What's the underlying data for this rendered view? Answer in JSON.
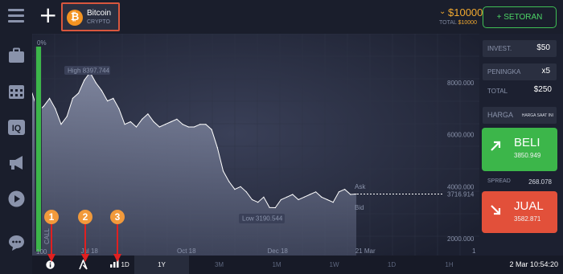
{
  "topbar": {
    "asset_name": "Bitcoin",
    "asset_type": "CRYPTO",
    "balance": "$10000",
    "total_label": "TOTAL",
    "total_value": "$10000",
    "deposit_label": "+ SETORAN",
    "coin_symbol": "₿"
  },
  "sidebar": {
    "icons": [
      "menu-icon",
      "briefcase-icon",
      "calendar-icon",
      "iq-icon",
      "megaphone-icon",
      "play-icon",
      "chat-icon"
    ]
  },
  "chart": {
    "high_label": "High",
    "high_value": "8397.744",
    "low_label": "Low",
    "low_value": "3190.544",
    "current_value": "3716.914",
    "ask_label": "Ask",
    "bid_label": "Bid",
    "left_pct_label": "0%",
    "call_label": "CALL",
    "left_bottom_label": "100",
    "y_ticks": [
      "8000.000",
      "6000.000",
      "4000.000",
      "2000.000"
    ],
    "x_ticks": [
      "Jul 18",
      "Oct 18",
      "Dec 18",
      "21 Mar"
    ],
    "x_edge_label": "1"
  },
  "chart_data": {
    "type": "area",
    "title": "",
    "xlabel": "",
    "ylabel": "",
    "ylim": [
      2000,
      9000
    ],
    "x_ticks": [
      "Jul 18",
      "Oct 18",
      "Dec 18",
      "21 Mar"
    ],
    "series": [
      {
        "values": [
          7600,
          6900,
          7100,
          7400,
          7000,
          6400,
          6700,
          7400,
          7600,
          8100,
          8397.744,
          8000,
          7700,
          7300,
          7400,
          7000,
          6400,
          6500,
          6300,
          6600,
          6800,
          6500,
          6300,
          6400,
          6500,
          6600,
          6400,
          6300,
          6300,
          6400,
          6400,
          6200,
          5500,
          4600,
          4200,
          3900,
          4000,
          3800,
          3500,
          3400,
          3600,
          3200,
          3190.544,
          3500,
          3600,
          3700,
          3500,
          3600,
          3700,
          3800,
          3600,
          3500,
          3400,
          3800,
          3900,
          3700,
          3716.914
        ]
      }
    ]
  },
  "rpanel": {
    "invest_label": "INVEST.",
    "invest_value": "$50",
    "multiplier_label": "PENINGKA",
    "multiplier_value": "x5",
    "total_label": "TOTAL",
    "total_value": "$250",
    "price_label": "HARGA",
    "price_sub": "HARGA SAAT INI",
    "buy_label": "BELI",
    "buy_price": "3850.949",
    "spread_label": "SPREAD",
    "spread_value": "268.078",
    "sell_label": "JUAL",
    "sell_price": "3582.871"
  },
  "bottombar": {
    "timeframe_label": "1D",
    "periods": [
      "1Y",
      "3M",
      "1M",
      "1W",
      "1D",
      "1H"
    ],
    "active_period": "1Y",
    "clock": "2 Mar 10:54:20"
  },
  "annotations": {
    "markers": [
      "1",
      "2",
      "3"
    ]
  },
  "colors": {
    "accent_orange": "#f39321",
    "balance_gold": "#f0a830",
    "buy_green": "#3cb64a",
    "sell_red": "#e2503a",
    "marker_orange": "#f29a3b",
    "marker_arrow_red": "#e02020"
  }
}
